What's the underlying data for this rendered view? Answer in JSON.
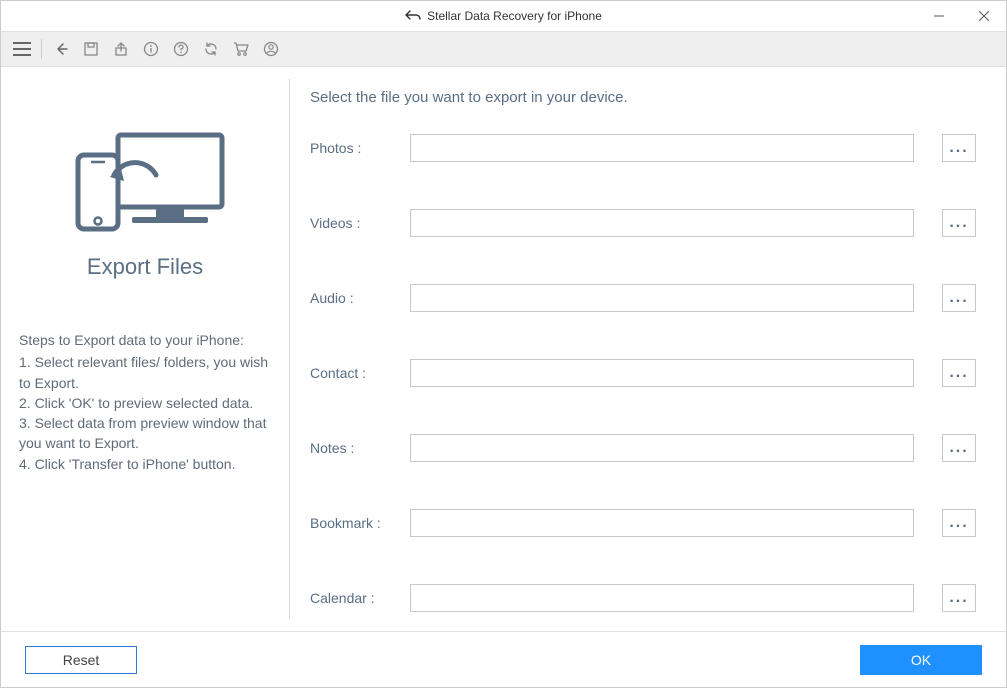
{
  "window": {
    "title": "Stellar Data Recovery for iPhone"
  },
  "sidebar": {
    "title": "Export Files",
    "steps_heading": "Steps to Export data to your iPhone:",
    "steps": [
      "1. Select relevant files/ folders, you wish to Export.",
      "2. Click 'OK' to preview selected data.",
      "3. Select data from preview window that you want to Export.",
      "4. Click 'Transfer to iPhone' button."
    ]
  },
  "main": {
    "instruction": "Select the file you want to export in your device.",
    "fields": [
      {
        "label": "Photos  :",
        "value": ""
      },
      {
        "label": "Videos :",
        "value": ""
      },
      {
        "label": "Audio :",
        "value": ""
      },
      {
        "label": "Contact :",
        "value": ""
      },
      {
        "label": "Notes :",
        "value": ""
      },
      {
        "label": "Bookmark :",
        "value": ""
      },
      {
        "label": "Calendar :",
        "value": ""
      }
    ],
    "browse_label": "..."
  },
  "footer": {
    "reset_label": "Reset",
    "ok_label": "OK"
  }
}
